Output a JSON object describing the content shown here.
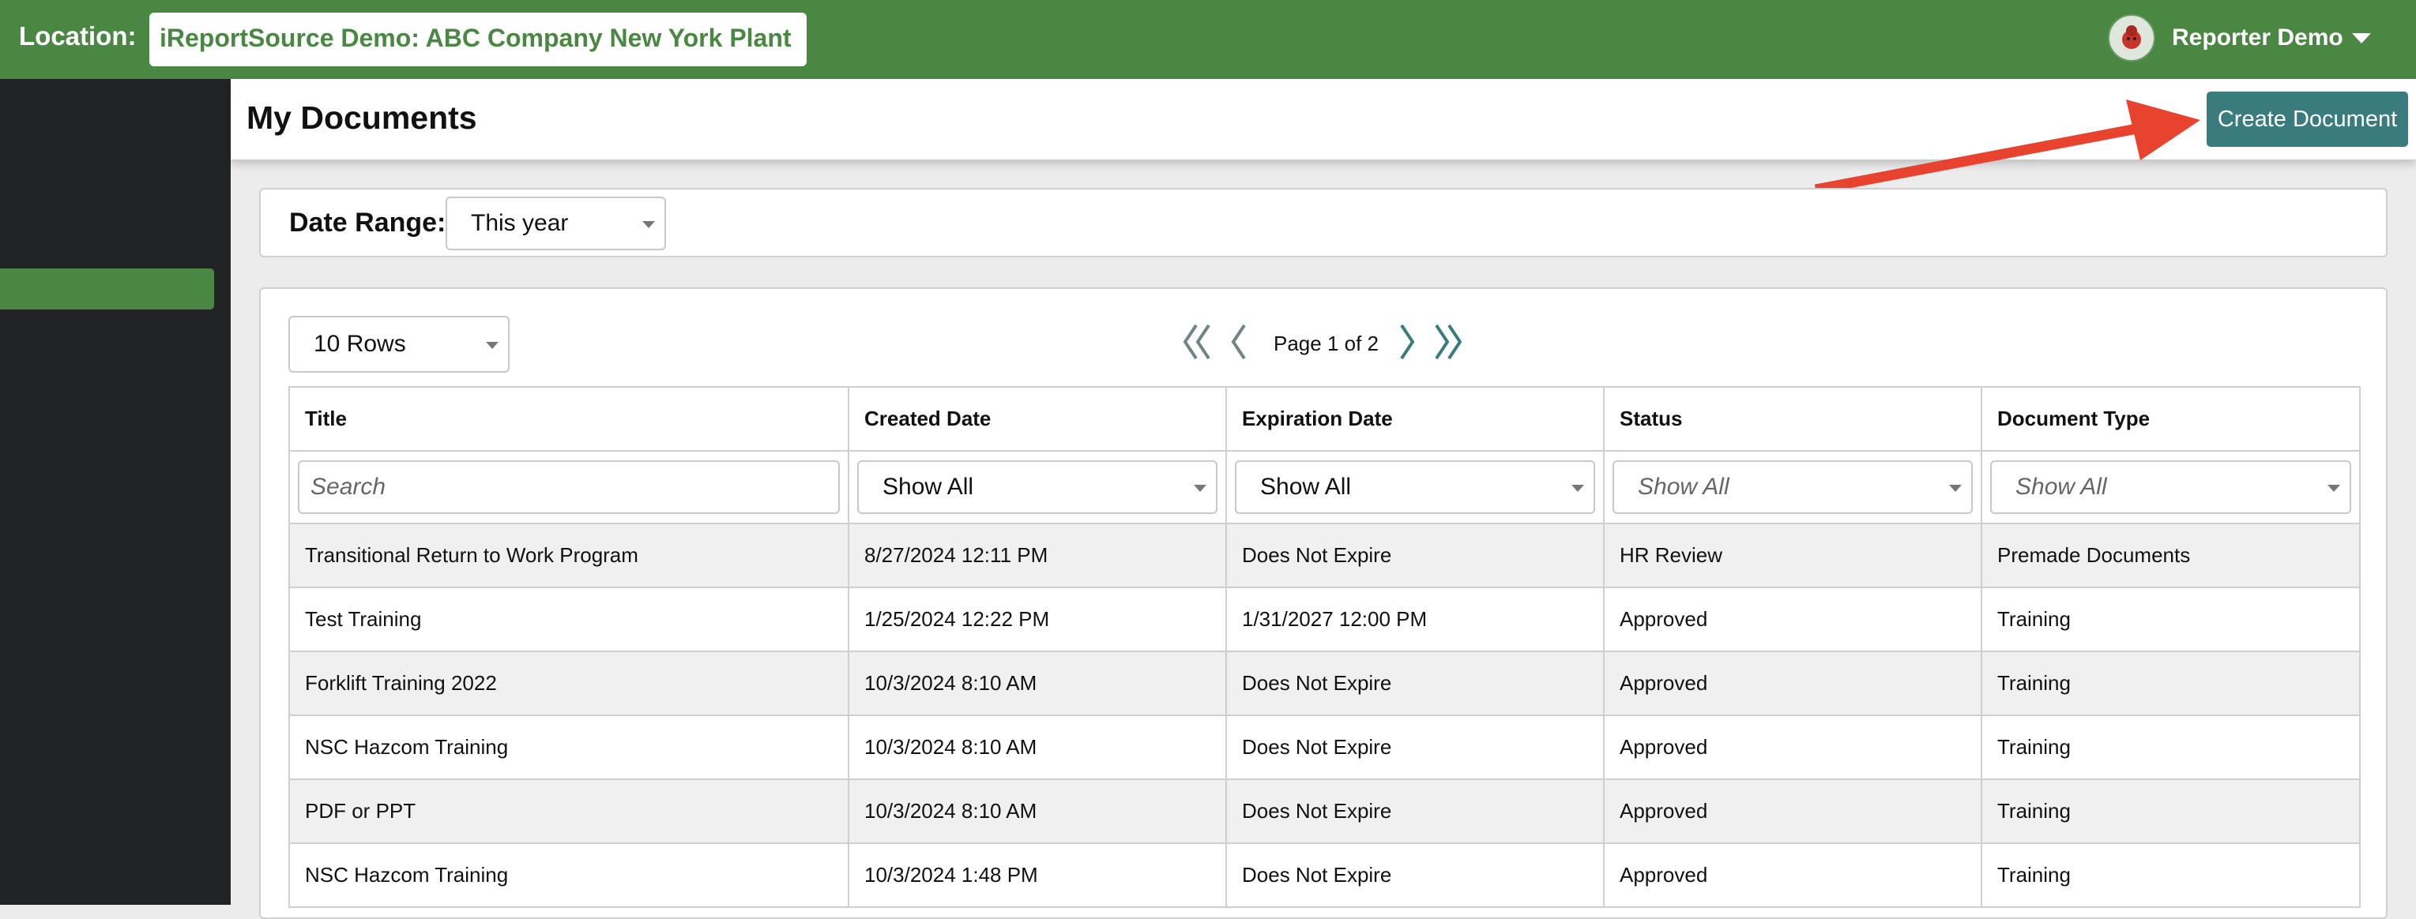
{
  "topbar": {
    "location_label": "Location:",
    "location_value": "iReportSource Demo: ABC Company New York Plant",
    "user_name": "Reporter Demo",
    "bg_color": "#4a8743"
  },
  "page": {
    "title": "My Documents",
    "create_button": "Create Document"
  },
  "filter": {
    "date_range_label": "Date Range:",
    "date_range_value": "This year"
  },
  "pager": {
    "rows_value": "10 Rows",
    "page_info": "Page 1 of 2"
  },
  "table": {
    "columns": [
      "Title",
      "Created Date",
      "Expiration Date",
      "Status",
      "Document Type"
    ],
    "search_placeholder": "Search",
    "filters": {
      "created": "Show All",
      "expiration": "Show All",
      "status": "Show All",
      "type": "Show All"
    },
    "rows": [
      [
        "Transitional Return to Work Program",
        "8/27/2024 12:11 PM",
        "Does Not Expire",
        "HR Review",
        "Premade Documents"
      ],
      [
        "Test Training",
        "1/25/2024 12:22 PM",
        "1/31/2027 12:00 PM",
        "Approved",
        "Training"
      ],
      [
        "Forklift Training 2022",
        "10/3/2024 8:10 AM",
        "Does Not Expire",
        "Approved",
        "Training"
      ],
      [
        "NSC Hazcom Training",
        "10/3/2024 8:10 AM",
        "Does Not Expire",
        "Approved",
        "Training"
      ],
      [
        "PDF or PPT",
        "10/3/2024 8:10 AM",
        "Does Not Expire",
        "Approved",
        "Training"
      ],
      [
        "NSC Hazcom Training",
        "10/3/2024 1:48 PM",
        "Does Not Expire",
        "Approved",
        "Training"
      ]
    ]
  },
  "colors": {
    "accent_green": "#4a8743",
    "button_teal": "#3a7b7e",
    "annotation_arrow": "#e8432e",
    "sidebar": "#222325"
  },
  "icons": [
    "user-avatar-icon",
    "chevron-down-icon",
    "first-page-icon",
    "prev-page-icon",
    "next-page-icon",
    "last-page-icon",
    "annotation-arrow"
  ]
}
